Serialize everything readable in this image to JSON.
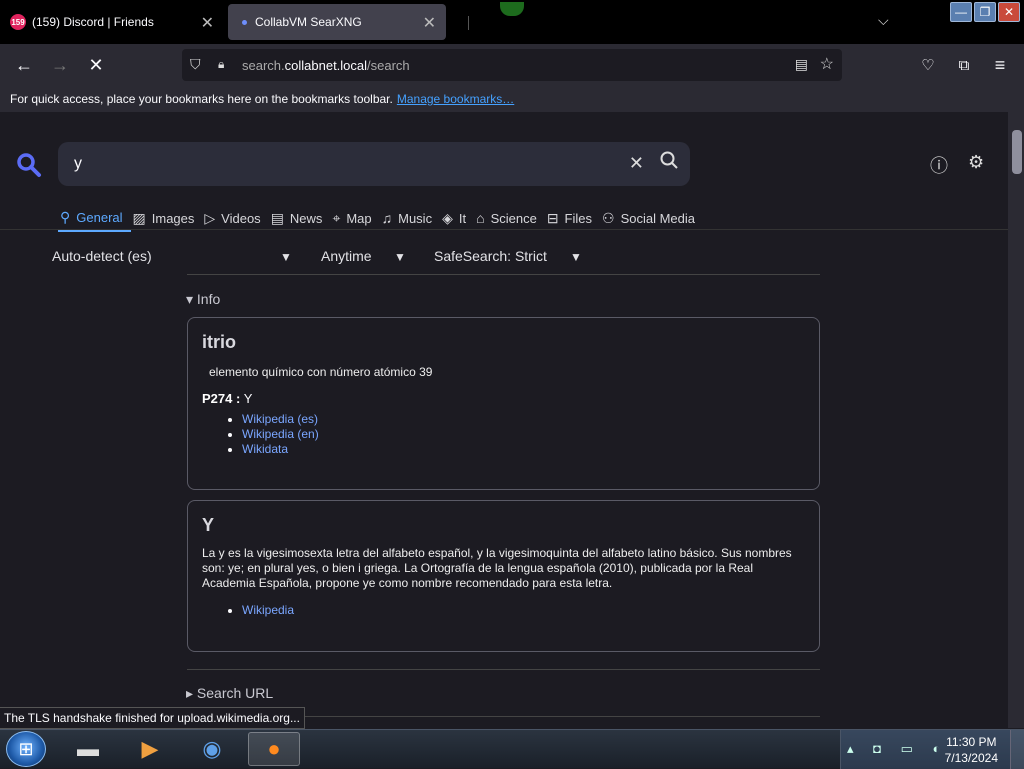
{
  "tabs": [
    {
      "title": "(159) Discord | Friends",
      "badge": "159",
      "close": "✕"
    },
    {
      "title": "CollabVM SearXNG",
      "close": "✕"
    }
  ],
  "window_buttons": {
    "minimize": "—",
    "restore": "❐",
    "close": "✕"
  },
  "url": {
    "prefix": "search.",
    "host": "collabnet.local",
    "path": "/search"
  },
  "bookmarks_bar": {
    "message": "For quick access, place your bookmarks here on the bookmarks toolbar.",
    "link": "Manage bookmarks…"
  },
  "search": {
    "query": "y"
  },
  "categories": [
    {
      "label": "General",
      "icon": "search-icon"
    },
    {
      "label": "Images",
      "icon": "image-icon"
    },
    {
      "label": "Videos",
      "icon": "play-icon"
    },
    {
      "label": "News",
      "icon": "newspaper-icon"
    },
    {
      "label": "Map",
      "icon": "map-pin-icon"
    },
    {
      "label": "Music",
      "icon": "music-icon"
    },
    {
      "label": "It",
      "icon": "layers-icon"
    },
    {
      "label": "Science",
      "icon": "graduation-icon"
    },
    {
      "label": "Files",
      "icon": "files-icon"
    },
    {
      "label": "Social Media",
      "icon": "people-icon"
    }
  ],
  "filters": {
    "language": "Auto-detect (es)",
    "time": "Anytime",
    "safesearch": "SafeSearch: Strict"
  },
  "info_section": "Info",
  "infobox1": {
    "title": "itrio",
    "description": "elemento químico con número atómico 39",
    "prop_label": "P274 :",
    "prop_value": "Y",
    "links": [
      "Wikipedia (es)",
      "Wikipedia (en)",
      "Wikidata"
    ]
  },
  "infobox2": {
    "title": "Y",
    "text": "La y es la vigesimosexta letra del alfabeto español, y la vigesimoquinta del alfabeto latino básico. Sus nombres son: ye; en plural yes, o bien i griega. La Ortografía de la lengua española (2010), publicada por la Real Academia Española, propone ye como nombre recomendado para esta letra.",
    "links": [
      "Wikipedia"
    ]
  },
  "search_url_section": "Search URL",
  "status_text": "The TLS handshake finished for upload.wikimedia.org...",
  "clock": {
    "time": "11:30 PM",
    "date": "7/13/2024"
  }
}
